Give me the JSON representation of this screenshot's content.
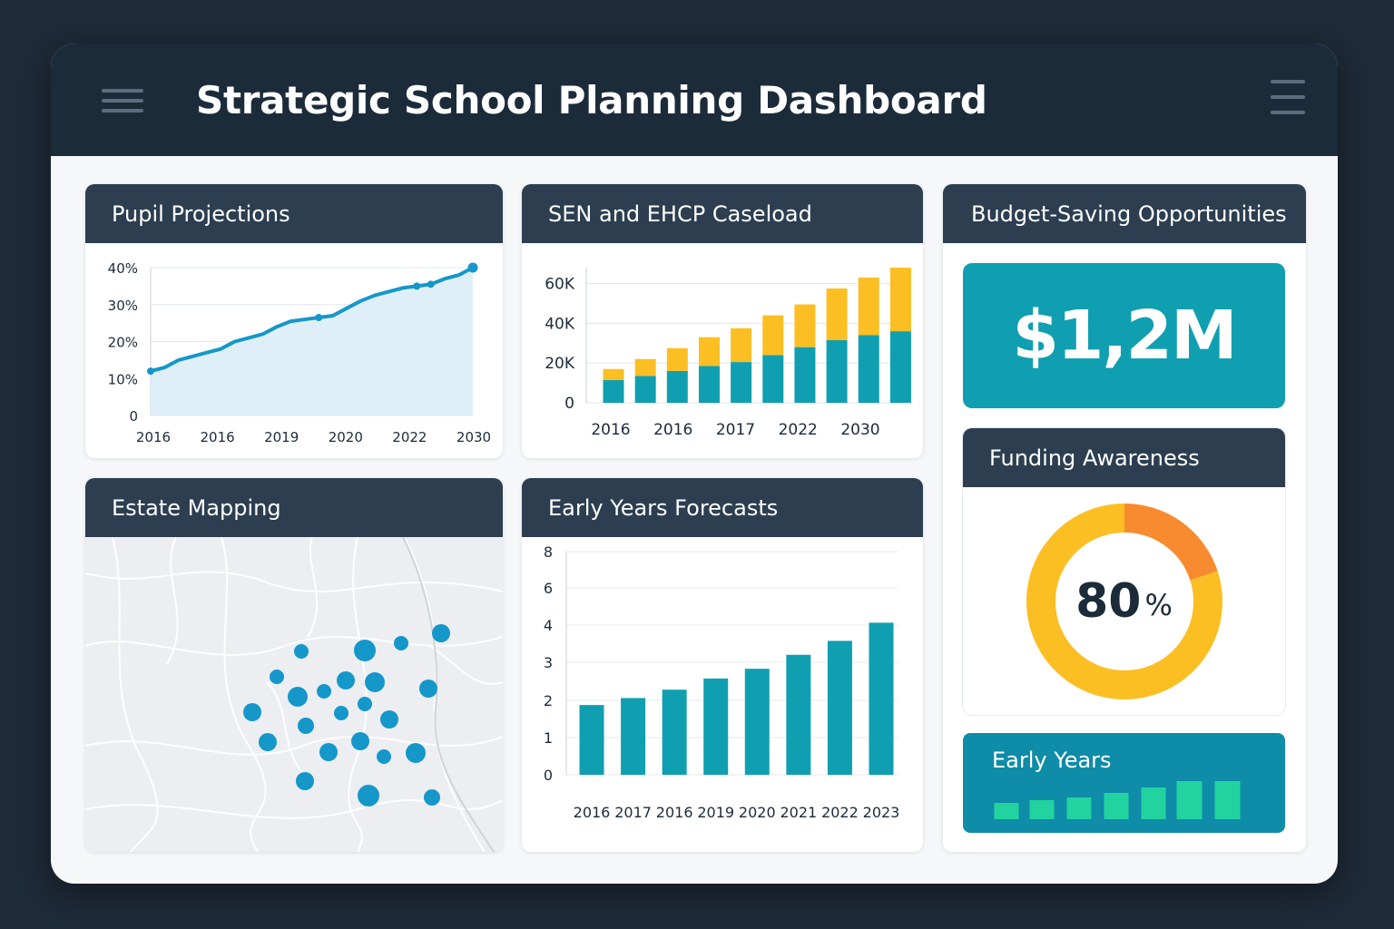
{
  "app": {
    "title": "Strategic School Planning Dashboard",
    "left_icon": "hamburger-menu-icon",
    "right_icon": "hamburger-menu-icon"
  },
  "colors": {
    "header": "#1c2b3a",
    "card_header": "#2c3e50",
    "teal": "#109fb0",
    "yellow": "#fbbf24",
    "orange": "#f88b2f",
    "green": "#22d3a0",
    "line_blue": "#1597c9"
  },
  "panels": {
    "pupil": {
      "title": "Pupil Projections"
    },
    "sen": {
      "title": "SEN and EHCP Caseload"
    },
    "budget": {
      "title": "Budget-Saving Opportunities",
      "value": "$1,2M"
    },
    "estate": {
      "title": "Estate Mapping"
    },
    "early_years_forecasts": {
      "title": "Early Years Forecasts"
    },
    "funding": {
      "title": "Funding Awareness",
      "value": "80",
      "unit": "%",
      "percent": 80
    },
    "early_years": {
      "title": "Early Years"
    }
  },
  "chart_data": [
    {
      "id": "pupil",
      "type": "area",
      "x_tick_labels": [
        "2016",
        "2016",
        "2019",
        "2020",
        "2022",
        "2030"
      ],
      "y_tick_labels": [
        "0",
        "10%",
        "20%",
        "30%",
        "40%"
      ],
      "ylim": [
        0,
        40
      ],
      "grid": true,
      "series": [
        {
          "values": [
            12,
            13,
            15,
            16,
            17,
            18,
            20,
            21,
            22,
            24,
            25.5,
            26,
            26.5,
            27,
            29,
            31,
            32.5,
            33.5,
            34.5,
            35,
            35.5,
            37,
            38,
            40
          ],
          "markers": [
            0,
            12,
            19,
            20,
            23
          ]
        }
      ]
    },
    {
      "id": "sen",
      "type": "bar",
      "stacked": true,
      "x_tick_labels": [
        "2016",
        "2016",
        "2017",
        "2022",
        "2030"
      ],
      "y_tick_labels": [
        "0",
        "20K",
        "40K",
        "60K"
      ],
      "ylim": [
        0,
        68000
      ],
      "grid": true,
      "series": [
        {
          "color": "#109fb0",
          "values": [
            11500,
            13500,
            16000,
            18500,
            20500,
            24000,
            28000,
            31500,
            34000,
            36000
          ]
        },
        {
          "color": "#fbbf24",
          "values": [
            5500,
            8500,
            11500,
            14500,
            17000,
            20000,
            21500,
            26000,
            29000,
            32000
          ]
        }
      ]
    },
    {
      "id": "early_years_forecasts",
      "type": "bar",
      "categories": [
        "2016",
        "2017",
        "2016",
        "2019",
        "2020",
        "2021",
        "2022",
        "2023"
      ],
      "y_tick_labels": [
        "0",
        "1",
        "2",
        "3",
        "4",
        "6",
        "8"
      ],
      "values": [
        2.5,
        2.75,
        3.05,
        3.45,
        3.8,
        4.3,
        4.8,
        5.45
      ],
      "ylim": [
        0,
        8
      ],
      "grid": true
    },
    {
      "id": "funding",
      "type": "pie",
      "slices": [
        {
          "value": 80,
          "color": "#fbbf24"
        },
        {
          "value": 20,
          "color": "#f88b2f"
        }
      ]
    },
    {
      "id": "early_years_mini",
      "type": "bar",
      "values": [
        1.8,
        2.1,
        2.4,
        2.9,
        3.5,
        4.2,
        4.2
      ]
    }
  ],
  "map": {
    "pins": [
      [
        276,
        670,
        8
      ],
      [
        346,
        669,
        12
      ],
      [
        386,
        661,
        8
      ],
      [
        430,
        650,
        10
      ],
      [
        249,
        698,
        8
      ],
      [
        325,
        702,
        10
      ],
      [
        357,
        704,
        11
      ],
      [
        272,
        720,
        11
      ],
      [
        301,
        714,
        8
      ],
      [
        416,
        711,
        10
      ],
      [
        346,
        728,
        8
      ],
      [
        222,
        737,
        10
      ],
      [
        320,
        738,
        8
      ],
      [
        373,
        745,
        10
      ],
      [
        281,
        752,
        9
      ],
      [
        239,
        770,
        10
      ],
      [
        341,
        769,
        10
      ],
      [
        306,
        781,
        10
      ],
      [
        367,
        786,
        8
      ],
      [
        402,
        782,
        11
      ],
      [
        280,
        813,
        10
      ],
      [
        350,
        829,
        12
      ],
      [
        420,
        831,
        9
      ]
    ]
  }
}
